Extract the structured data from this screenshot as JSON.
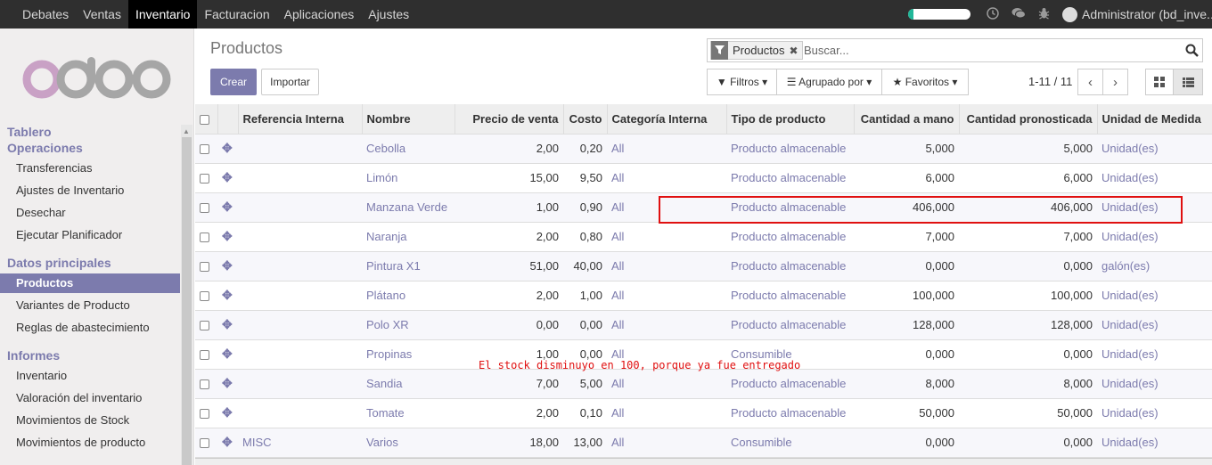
{
  "topbar": {
    "menus": [
      "Debates",
      "Ventas",
      "Inventario",
      "Facturacion",
      "Aplicaciones",
      "Ajustes"
    ],
    "active_menu": "Inventario",
    "progress_fraction": 0.06,
    "user": "Administrator (bd_inve..."
  },
  "sidebar": {
    "logo": "odoo",
    "sections": [
      {
        "heading": "Tablero"
      },
      {
        "heading": "Operaciones",
        "items": [
          "Transferencias",
          "Ajustes de Inventario",
          "Desechar",
          "Ejecutar Planificador"
        ]
      },
      {
        "heading": "Datos principales",
        "items": [
          "Productos",
          "Variantes de Producto",
          "Reglas de abastecimiento"
        ]
      },
      {
        "heading": "Informes",
        "items": [
          "Inventario",
          "Valoración del inventario",
          "Movimientos de Stock",
          "Movimientos de producto"
        ]
      }
    ],
    "active_item": "Productos"
  },
  "control": {
    "title": "Productos",
    "create": "Crear",
    "import": "Importar",
    "facet": "Productos",
    "search_placeholder": "Buscar...",
    "filters": "Filtros",
    "group_by": "Agrupado por",
    "favorites": "Favoritos",
    "pager": "1-11 / 11"
  },
  "table": {
    "columns": [
      "Referencia Interna",
      "Nombre",
      "Precio de venta",
      "Costo",
      "Categoría Interna",
      "Tipo de producto",
      "Cantidad a mano",
      "Cantidad pronosticada",
      "Unidad de Medida"
    ],
    "rows": [
      [
        "",
        "Cebolla",
        "2,00",
        "0,20",
        "All",
        "Producto almacenable",
        "5,000",
        "5,000",
        "Unidad(es)"
      ],
      [
        "",
        "Limón",
        "15,00",
        "9,50",
        "All",
        "Producto almacenable",
        "6,000",
        "6,000",
        "Unidad(es)"
      ],
      [
        "",
        "Manzana Verde",
        "1,00",
        "0,90",
        "All",
        "Producto almacenable",
        "406,000",
        "406,000",
        "Unidad(es)"
      ],
      [
        "",
        "Naranja",
        "2,00",
        "0,80",
        "All",
        "Producto almacenable",
        "7,000",
        "7,000",
        "Unidad(es)"
      ],
      [
        "",
        "Pintura X1",
        "51,00",
        "40,00",
        "All",
        "Producto almacenable",
        "0,000",
        "0,000",
        "galón(es)"
      ],
      [
        "",
        "Plátano",
        "2,00",
        "1,00",
        "All",
        "Producto almacenable",
        "100,000",
        "100,000",
        "Unidad(es)"
      ],
      [
        "",
        "Polo XR",
        "0,00",
        "0,00",
        "All",
        "Producto almacenable",
        "128,000",
        "128,000",
        "Unidad(es)"
      ],
      [
        "",
        "Propinas",
        "1,00",
        "0,00",
        "All",
        "Consumible",
        "0,000",
        "0,000",
        "Unidad(es)"
      ],
      [
        "",
        "Sandia",
        "7,00",
        "5,00",
        "All",
        "Producto almacenable",
        "8,000",
        "8,000",
        "Unidad(es)"
      ],
      [
        "",
        "Tomate",
        "2,00",
        "0,10",
        "All",
        "Producto almacenable",
        "50,000",
        "50,000",
        "Unidad(es)"
      ],
      [
        "MISC",
        "Varios",
        "18,00",
        "13,00",
        "All",
        "Consumible",
        "0,000",
        "0,000",
        "Unidad(es)"
      ]
    ]
  },
  "annotation": "El stock disminuyo en 100, porque ya fue entregado"
}
